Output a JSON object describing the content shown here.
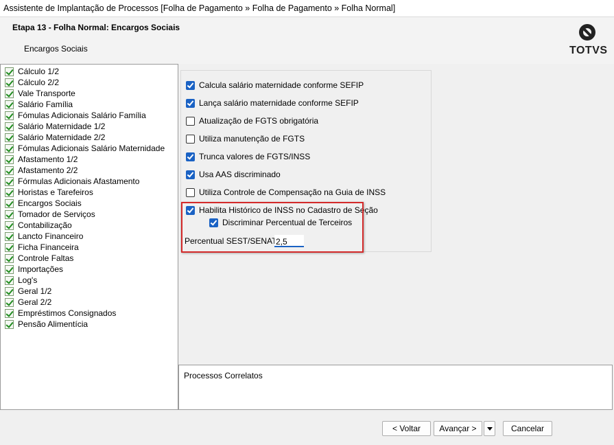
{
  "window": {
    "title": "Assistente de Implantação de Processos [Folha de Pagamento » Folha de Pagamento » Folha Normal]"
  },
  "header": {
    "step_title": "Etapa 13 - Folha Normal: Encargos Sociais",
    "step_subtitle": "Encargos Sociais",
    "logo_text": "TOTVS"
  },
  "tree": {
    "items": [
      "Cálculo 1/2",
      "Cálculo 2/2",
      "Vale Transporte",
      "Salário Família",
      "Fómulas Adicionais Salário Família",
      "Salário Maternidade 1/2",
      "Salário Maternidade 2/2",
      "Fómulas Adicionais Salário Maternidade",
      "Afastamento 1/2",
      "Afastamento 2/2",
      "Fórmulas Adicionais Afastamento",
      "Horistas e Tarefeiros",
      "Encargos Sociais",
      "Tomador de Serviços",
      "Contabilização",
      "Lancto Financeiro",
      "Ficha Financeira",
      "Controle Faltas",
      "Importações",
      "Log's",
      "Geral 1/2",
      "Geral 2/2",
      "Empréstimos Consignados",
      "Pensão Alimentícia"
    ]
  },
  "options": [
    {
      "label": "Calcula salário maternidade conforme SEFIP",
      "checked": true
    },
    {
      "label": "Lança salário maternidade conforme SEFIP",
      "checked": true
    },
    {
      "label": "Atualização de FGTS obrigatória",
      "checked": false
    },
    {
      "label": "Utiliza manutenção de FGTS",
      "checked": false
    },
    {
      "label": "Trunca valores de FGTS/INSS",
      "checked": true
    },
    {
      "label": "Usa AAS discriminado",
      "checked": true
    },
    {
      "label": "Utiliza Controle de Compensação na Guia de INSS",
      "checked": false
    },
    {
      "label": "Habilita Histórico de INSS no Cadastro de Seção",
      "checked": true
    },
    {
      "label": "Discriminar Percentual de Terceiros",
      "checked": true
    }
  ],
  "sest_senat": {
    "label": "Percentual SEST/SENAT:",
    "value": "2,5"
  },
  "related": {
    "label": "Processos Correlatos"
  },
  "buttons": {
    "back": "< Voltar",
    "next": "Avançar >",
    "cancel": "Cancelar"
  }
}
